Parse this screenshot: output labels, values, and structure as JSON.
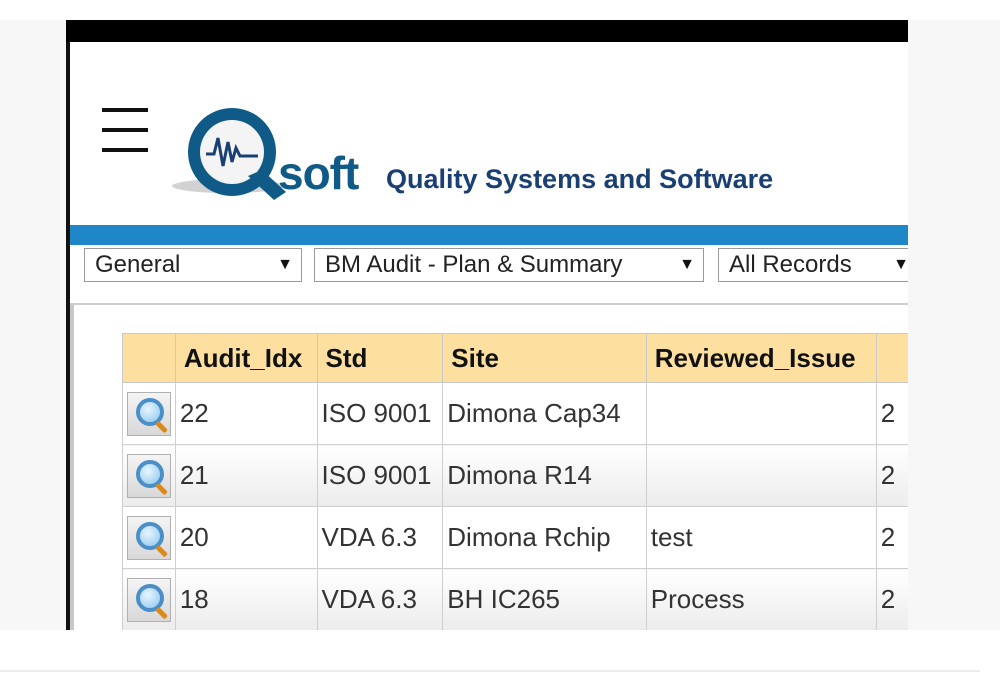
{
  "header": {
    "logo_text": "soft",
    "tagline": "Quality Systems and Software"
  },
  "filters": [
    {
      "value": "General"
    },
    {
      "value": "BM Audit - Plan & Summary"
    },
    {
      "value": "All Records"
    }
  ],
  "table": {
    "columns": [
      "",
      "Audit_Idx",
      "Std",
      "Site",
      "Reviewed_Issue",
      ""
    ],
    "rows": [
      {
        "audit_idx": "22",
        "std": "ISO 9001",
        "site": "Dimona Cap34",
        "reviewed_issue": "",
        "next": "2"
      },
      {
        "audit_idx": "21",
        "std": "ISO 9001",
        "site": "Dimona R14",
        "reviewed_issue": "",
        "next": "2"
      },
      {
        "audit_idx": "20",
        "std": "VDA 6.3",
        "site": "Dimona Rchip",
        "reviewed_issue": "test",
        "next": "2"
      },
      {
        "audit_idx": "18",
        "std": "VDA 6.3",
        "site": "BH IC265",
        "reviewed_issue": "Process",
        "next": "2"
      },
      {
        "audit_idx": "",
        "std": "",
        "site": "",
        "reviewed_issue": "",
        "next": ""
      }
    ]
  },
  "icons": {
    "menu": "hamburger-menu-icon",
    "view": "magnifier-icon",
    "dropdown": "caret-down-icon"
  },
  "colors": {
    "accent_bar": "#1f86c8",
    "header_row": "#fddfa0",
    "logo_blue": "#0f5a86",
    "tagline": "#1a3f73"
  }
}
